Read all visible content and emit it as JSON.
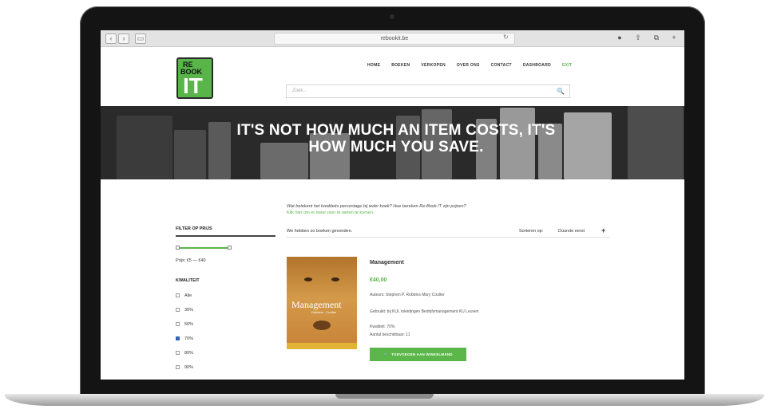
{
  "browser": {
    "back_glyph": "‹",
    "forward_glyph": "›",
    "sidebar_glyph": "▭",
    "url": "rebookit.be",
    "reload_glyph": "↻",
    "icons": [
      "download-icon",
      "share-icon",
      "tabs-icon",
      "add-tab-icon"
    ],
    "icon_glyphs": [
      "●",
      "⇧",
      "⧉",
      "+"
    ]
  },
  "site": {
    "logo": {
      "line1": "RE",
      "line2": "BOOK",
      "line3": "IT"
    },
    "nav": [
      "HOME",
      "BOEKEN",
      "VERKOPEN",
      "OVER ONS",
      "CONTACT",
      "DASHBOARD",
      "EXIT"
    ],
    "search_placeholder": "Zoek...",
    "search_glyph": "🔍",
    "hero": {
      "line1": "IT'S NOT HOW MUCH AN ITEM COSTS, IT'S",
      "line2": "HOW MUCH YOU SAVE."
    }
  },
  "filters": {
    "price_title": "FILTER OP PRIJS",
    "price_range": "Prijs: €5 — €40",
    "quality_title": "KWALITEIT",
    "quality_options": [
      {
        "label": "Alle",
        "checked": false
      },
      {
        "label": "30%",
        "checked": false
      },
      {
        "label": "50%",
        "checked": false
      },
      {
        "label": "70%",
        "checked": true
      },
      {
        "label": "80%",
        "checked": false
      },
      {
        "label": "90%",
        "checked": false
      }
    ]
  },
  "listing": {
    "question": "Wat betekent het kwaliteits percentage bij ieder boek? Hoe bereken Re-Book IT zijn prijzen?",
    "question_link": "Klik hier om er meer over te weten te komen.",
    "results_text": "We hebben zo boeken gevonden.",
    "sort_label": "Sorteren op:",
    "sort_value": "Duurste eerst",
    "sort_glyph": "+"
  },
  "product": {
    "title": "Management",
    "price": "€40,00",
    "authors": "Auteurs: Stephen P. Robbins Mary Coulter",
    "course": "Gebruikt: bij KUL Inleidingen Bedrijfsmanagement KU Leuven",
    "quality": "Kwaliteit: 70%",
    "remarks": "Aantal beschikbaar: 11",
    "cover_title": "Management",
    "cover_subtitle": "Robbins · Coulter",
    "cart_glyph": "🛒",
    "cart_label": "TOEVOEGEN AAN WINKELMAND"
  },
  "slider": {
    "min_fraction": 0.0,
    "max_fraction": 1.0
  }
}
